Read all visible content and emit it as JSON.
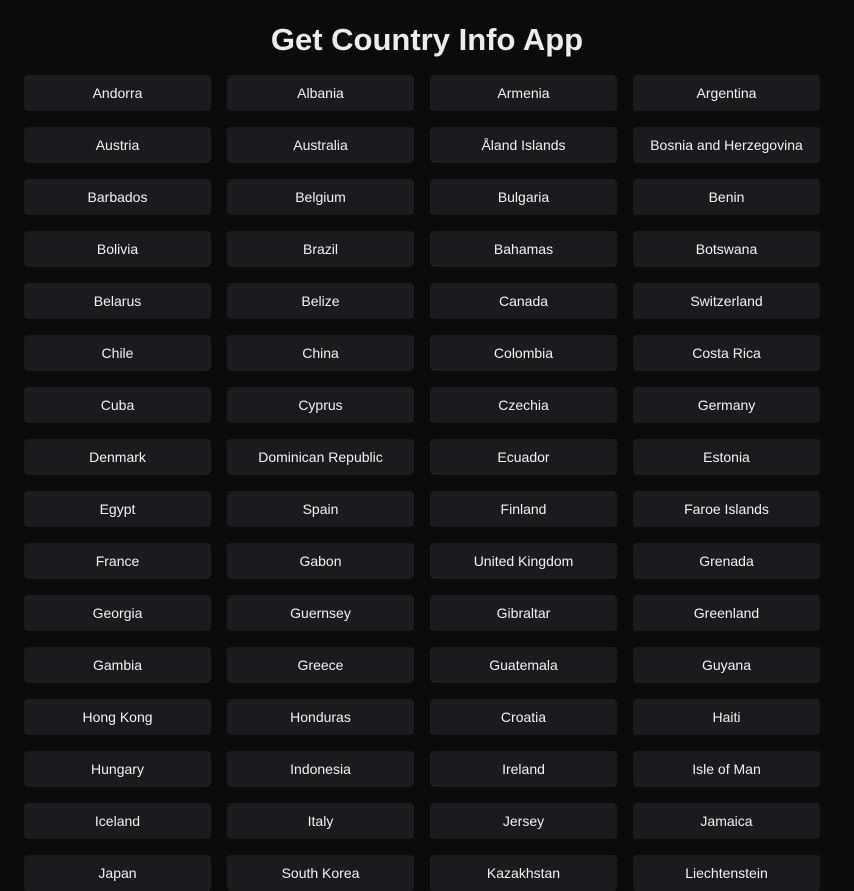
{
  "app": {
    "title": "Get Country Info App"
  },
  "countries": [
    "Andorra",
    "Albania",
    "Armenia",
    "Argentina",
    "Austria",
    "Australia",
    "Åland Islands",
    "Bosnia and Herzegovina",
    "Barbados",
    "Belgium",
    "Bulgaria",
    "Benin",
    "Bolivia",
    "Brazil",
    "Bahamas",
    "Botswana",
    "Belarus",
    "Belize",
    "Canada",
    "Switzerland",
    "Chile",
    "China",
    "Colombia",
    "Costa Rica",
    "Cuba",
    "Cyprus",
    "Czechia",
    "Germany",
    "Denmark",
    "Dominican Republic",
    "Ecuador",
    "Estonia",
    "Egypt",
    "Spain",
    "Finland",
    "Faroe Islands",
    "France",
    "Gabon",
    "United Kingdom",
    "Grenada",
    "Georgia",
    "Guernsey",
    "Gibraltar",
    "Greenland",
    "Gambia",
    "Greece",
    "Guatemala",
    "Guyana",
    "Hong Kong",
    "Honduras",
    "Croatia",
    "Haiti",
    "Hungary",
    "Indonesia",
    "Ireland",
    "Isle of Man",
    "Iceland",
    "Italy",
    "Jersey",
    "Jamaica",
    "Japan",
    "South Korea",
    "Kazakhstan",
    "Liechtenstein"
  ]
}
